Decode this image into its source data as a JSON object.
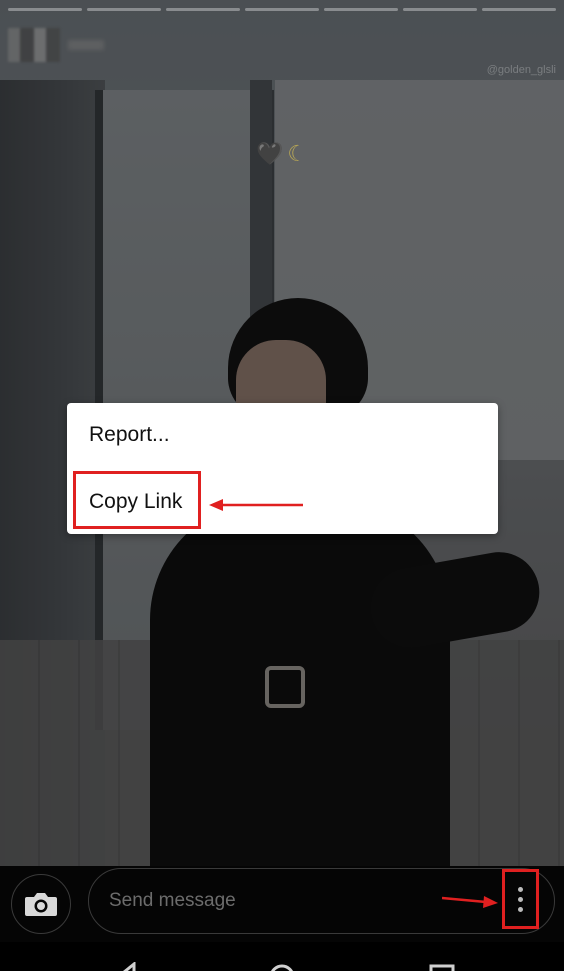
{
  "story": {
    "progress_segments": 7,
    "viewed_segments": 0,
    "watermark": "@golden_glsli",
    "sticker": {
      "heart": "🖤",
      "moon": "☾"
    }
  },
  "menu": {
    "items": [
      {
        "label": "Report..."
      },
      {
        "label": "Copy Link"
      }
    ]
  },
  "annotations": {
    "highlight_color": "#e02020"
  },
  "bottom_bar": {
    "camera_icon": "camera-icon",
    "message_placeholder": "Send message",
    "more_icon": "more-vertical-icon"
  },
  "nav_bar": {
    "buttons": [
      "back-icon",
      "home-icon",
      "recents-icon"
    ]
  }
}
